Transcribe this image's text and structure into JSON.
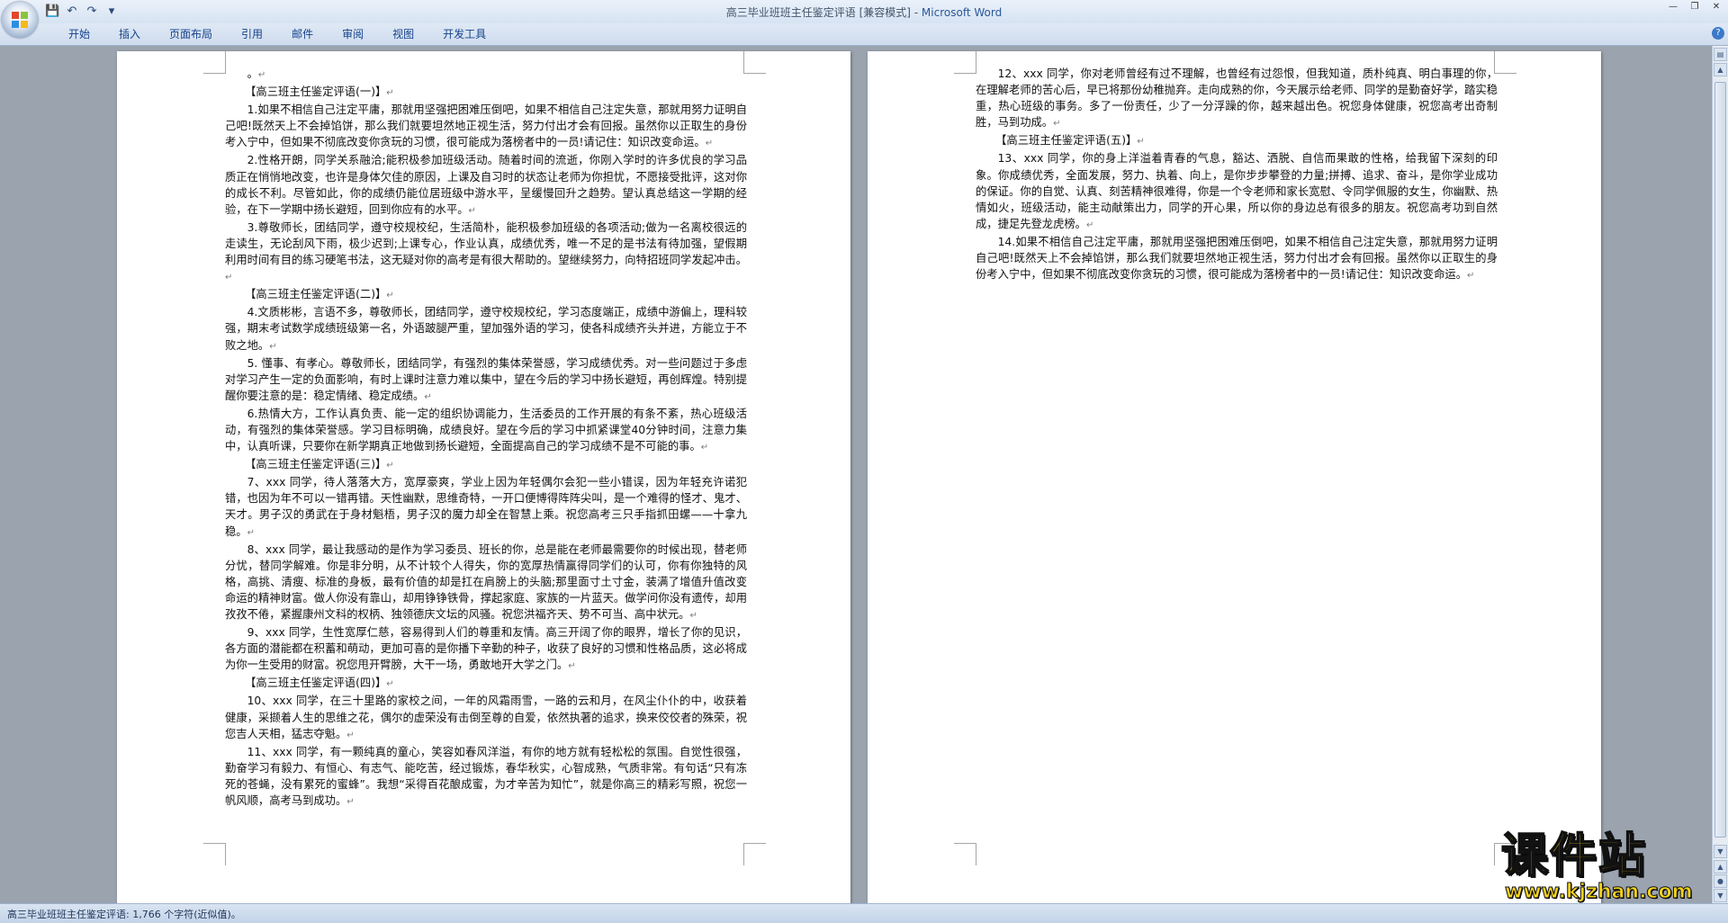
{
  "window": {
    "title": "高三毕业班班主任鉴定评语 [兼容模式] - ",
    "app_name": "Microsoft Word"
  },
  "quick_access": {
    "icons": [
      "save-icon",
      "undo-icon",
      "redo-icon",
      "customize-icon"
    ]
  },
  "ribbon": {
    "tabs": [
      {
        "label": "开始"
      },
      {
        "label": "插入"
      },
      {
        "label": "页面布局"
      },
      {
        "label": "引用"
      },
      {
        "label": "邮件"
      },
      {
        "label": "审阅"
      },
      {
        "label": "视图"
      },
      {
        "label": "开发工具"
      }
    ]
  },
  "document": {
    "left_page": [
      {
        "kind": "p",
        "text": "。"
      },
      {
        "kind": "h",
        "text": "【高三班主任鉴定评语(一)】"
      },
      {
        "kind": "p",
        "text": "1.如果不相信自己注定平庸，那就用坚强把困难压倒吧，如果不相信自己注定失意，那就用努力证明自己吧!既然天上不会掉馅饼，那么我们就要坦然地正视生活，努力付出才会有回报。虽然你以正取生的身份考入宁中，但如果不彻底改变你贪玩的习惯，很可能成为落榜者中的一员!请记住：知识改变命运。"
      },
      {
        "kind": "p",
        "text": "2.性格开朗，同学关系融洽;能积极参加班级活动。随着时间的流逝，你刚入学时的许多优良的学习品质正在悄悄地改变，也许是身体欠佳的原因，上课及自习时的状态让老师为你担忧，不愿接受批评，这对你的成长不利。尽管如此，你的成绩仍能位居班级中游水平，呈缓慢回升之趋势。望认真总结这一学期的经验，在下一学期中扬长避短，回到你应有的水平。"
      },
      {
        "kind": "p",
        "text": "3.尊敬师长，团结同学，遵守校规校纪，生活简朴，能积极参加班级的各项活动;做为一名离校很远的走读生，无论刮风下雨，极少迟到;上课专心，作业认真，成绩优秀，唯一不足的是书法有待加强，望假期利用时间有目的练习硬笔书法，这无疑对你的高考是有很大帮助的。望继续努力，向特招班同学发起冲击。"
      },
      {
        "kind": "h",
        "text": "【高三班主任鉴定评语(二)】"
      },
      {
        "kind": "p",
        "text": "4.文质彬彬，言语不多，尊敬师长，团结同学，遵守校规校纪，学习态度端正，成绩中游偏上，理科较强，期末考试数学成绩班级第一名，外语跛腿严重，望加强外语的学习，使各科成绩齐头并进，方能立于不败之地。"
      },
      {
        "kind": "p",
        "text": "5. 懂事、有孝心。尊敬师长，团结同学，有强烈的集体荣誉感，学习成绩优秀。对一些问题过于多虑对学习产生一定的负面影响，有时上课时注意力难以集中，望在今后的学习中扬长避短，再创辉煌。特别提醒你要注意的是：稳定情绪、稳定成绩。"
      },
      {
        "kind": "p",
        "text": "6.热情大方，工作认真负责、能一定的组织协调能力，生活委员的工作开展的有条不紊，热心班级活动，有强烈的集体荣誉感。学习目标明确，成绩良好。望在今后的学习中抓紧课堂40分钟时间，注意力集中，认真听课，只要你在新学期真正地做到扬长避短，全面提高自己的学习成绩不是不可能的事。"
      },
      {
        "kind": "h",
        "text": "【高三班主任鉴定评语(三)】"
      },
      {
        "kind": "p",
        "text": "7、xxx 同学，待人落落大方，宽厚豪爽，学业上因为年轻偶尔会犯一些小错误，因为年轻充许诺犯错，也因为年不可以一错再错。天性幽默，思维奇特，一开口便博得阵阵尖叫，是一个难得的怪才、鬼才、天才。男子汉的勇武在于身材魁梧，男子汉的魔力却全在智慧上乘。祝您高考三只手指抓田螺——十拿九稳。"
      },
      {
        "kind": "p",
        "text": "8、xxx 同学，最让我感动的是作为学习委员、班长的你，总是能在老师最需要你的时候出现，替老师分忧，替同学解难。你是非分明，从不计较个人得失，你的宽厚热情赢得同学们的认可，你有你独特的风格，高挑、清瘦、标准的身板，最有价值的却是扛在肩膀上的头脑;那里面寸土寸金，装满了增值升值改变命运的精神财富。做人你没有靠山，却用铮铮铁骨，撑起家庭、家族的一片蓝天。做学问你没有遗传，却用孜孜不倦，紧握康州文科的权柄、独领德庆文坛的风骚。祝您洪福齐天、势不可当、高中状元。"
      },
      {
        "kind": "p",
        "text": "9、xxx 同学，生性宽厚仁慈，容易得到人们的尊重和友情。高三开阔了你的眼界，增长了你的见识，各方面的潜能都在积蓄和萌动，更加可喜的是你播下辛勤的种子，收获了良好的习惯和性格品质，这必将成为你一生受用的财富。祝您甩开臂膀，大干一场，勇敢地开大学之门。"
      },
      {
        "kind": "h",
        "text": "【高三班主任鉴定评语(四)】"
      },
      {
        "kind": "p",
        "text": "10、xxx 同学，在三十里路的家校之间，一年的风霜雨雪，一路的云和月，在风尘仆仆的中，收获着健康，采撷着人生的思维之花，偶尔的虚荣没有击倒至尊的自爱，依然执著的追求，换来佼佼者的殊荣，祝您吉人天相，猛志夺魁。"
      },
      {
        "kind": "p",
        "text": "11、xxx 同学，有一颗纯真的童心，笑容如春风洋溢，有你的地方就有轻松松的氛围。自觉性很强，勤奋学习有毅力、有恒心、有志气、能吃苦，经过锻炼，春华秋实，心智成熟，气质非常。有句话“只有冻死的苍蝇，没有累死的蜜蜂”。我想“采得百花酿成蜜，为才辛苦为知忙”，就是你高三的精彩写照，祝您一帆风顺，高考马到成功。"
      }
    ],
    "right_page": [
      {
        "kind": "p",
        "text": "12、xxx 同学，你对老师曾经有过不理解，也曾经有过怨恨，但我知道，质朴纯真、明白事理的你，在理解老师的苦心后，早已将那份幼稚抛弃。走向成熟的你，今天展示给老师、同学的是勤奋好学，踏实稳重，热心班级的事务。多了一份责任，少了一分浮躁的你，越来越出色。祝您身体健康，祝您高考出奇制胜，马到功成。"
      },
      {
        "kind": "h",
        "text": "【高三班主任鉴定评语(五)】"
      },
      {
        "kind": "p",
        "text": "13、xxx 同学，你的身上洋溢着青春的气息，豁达、洒脱、自信而果敢的性格，给我留下深刻的印象。你成绩优秀，全面发展，努力、执着、向上，是你步步攀登的力量;拼搏、追求、奋斗，是你学业成功的保证。你的自觉、认真、刻苦精神很难得，你是一个令老师和家长宽慰、令同学佩服的女生，你幽默、热情如火，班级活动，能主动献策出力，同学的开心果，所以你的身边总有很多的朋友。祝您高考功到自然成，捷足先登龙虎榜。"
      },
      {
        "kind": "p",
        "text": "14.如果不相信自己注定平庸，那就用坚强把困难压倒吧，如果不相信自己注定失意，那就用努力证明自己吧!既然天上不会掉馅饼，那么我们就要坦然地正视生活，努力付出才会有回报。虽然你以正取生的身份考入宁中，但如果不彻底改变你贪玩的习惯，很可能成为落榜者中的一员!请记住：知识改变命运。"
      }
    ]
  },
  "status_bar": {
    "text": "高三毕业班班主任鉴定评语: 1,766 个字符(近似值)。"
  },
  "watermark": {
    "brand": "课件站",
    "url": "www.kjzhan.com"
  },
  "colors": {
    "ribbon_text": "#15428b",
    "app_name": "#2b579a",
    "watermark": "#f4d21a"
  }
}
